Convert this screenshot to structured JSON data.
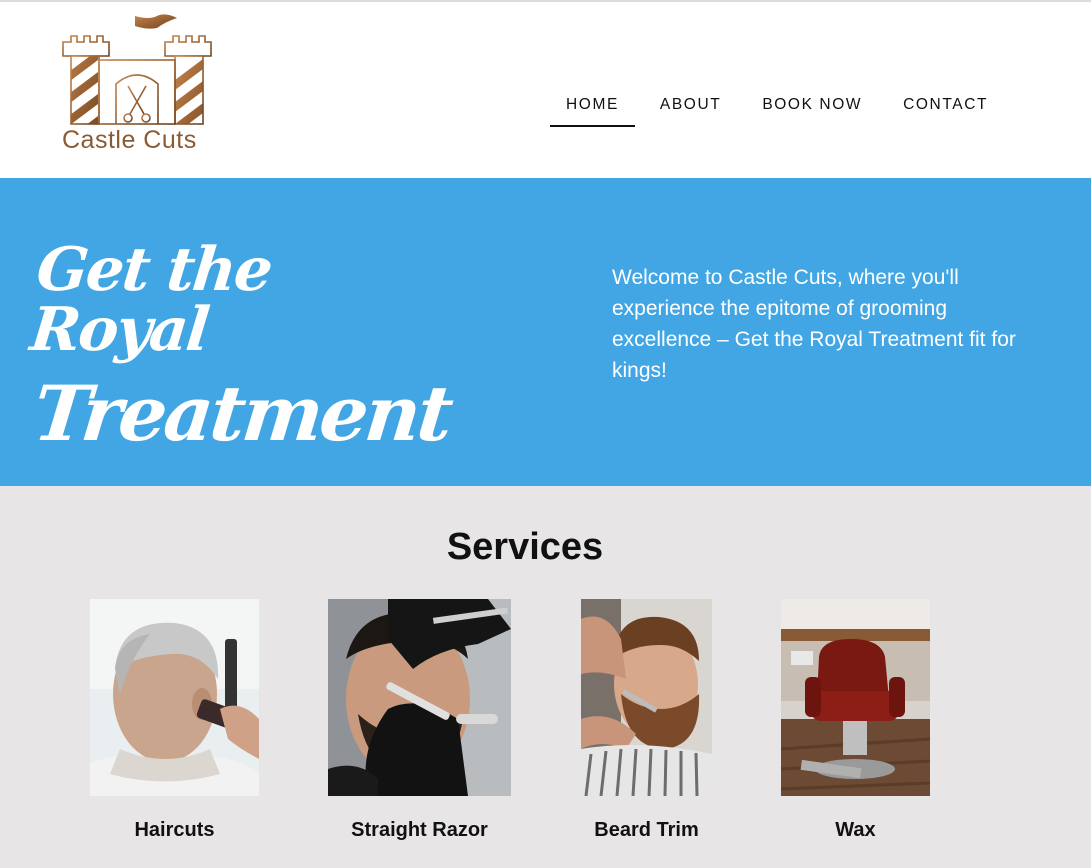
{
  "brand": {
    "name": "Castle Cuts",
    "logo_icon": "castle-scissors-logo",
    "colors": {
      "copper": "#8a5a33",
      "hero_blue": "#42a6e4",
      "services_bg": "#e7e5e6"
    }
  },
  "nav": {
    "items": [
      {
        "label": "HOME",
        "active": true
      },
      {
        "label": "ABOUT",
        "active": false
      },
      {
        "label": "BOOK NOW",
        "active": false
      },
      {
        "label": "CONTACT",
        "active": false
      }
    ]
  },
  "hero": {
    "title_line1": "Get the Royal",
    "title_line2": "Treatment",
    "text": "Welcome to Castle Cuts, where you'll experience the epitome of grooming excellence – Get the Royal Treatment fit for kings!"
  },
  "services": {
    "heading": "Services",
    "items": [
      {
        "label": "Haircuts",
        "image": "haircut-photo"
      },
      {
        "label": "Straight Razor",
        "image": "straight-razor-photo"
      },
      {
        "label": "Beard Trim",
        "image": "beard-trim-photo"
      },
      {
        "label": "Wax",
        "image": "barber-chair-photo"
      }
    ]
  }
}
